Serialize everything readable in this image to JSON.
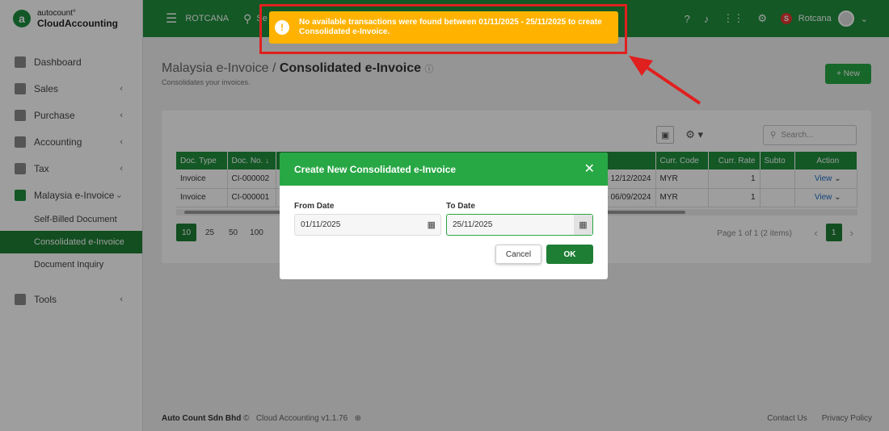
{
  "logo": {
    "top": "autocount°",
    "bottom": "CloudAccounting",
    "mark": "a"
  },
  "topbar": {
    "company": "ROTCANA",
    "search_partial": "Se",
    "user": "Rotcana",
    "badge": "S"
  },
  "sidebar": {
    "items": [
      {
        "label": "Dashboard"
      },
      {
        "label": "Sales"
      },
      {
        "label": "Purchase"
      },
      {
        "label": "Accounting"
      },
      {
        "label": "Tax"
      },
      {
        "label": "Malaysia e-Invoice"
      }
    ],
    "sub_items": [
      {
        "label": "Self-Billed Document"
      },
      {
        "label": "Consolidated e-Invoice"
      },
      {
        "label": "Document Inquiry"
      }
    ],
    "tools": "Tools"
  },
  "page": {
    "title_prefix": "Malaysia e-Invoice /",
    "title": "Consolidated e-Invoice",
    "subtitle": "Consolidates your invoices.",
    "new_button": "New",
    "search_placeholder": "Search..."
  },
  "table": {
    "headers": [
      "Doc. Type",
      "Doc. No.",
      "",
      "Curr. Code",
      "Curr. Rate",
      "Subto",
      "Action"
    ],
    "rows": [
      {
        "type": "Invoice",
        "no": "CI-000002",
        "range": "o 12/12/2024",
        "curr": "MYR",
        "rate": "1",
        "subtotal": "",
        "action": "View"
      },
      {
        "type": "Invoice",
        "no": "CI-000001",
        "range": "o 06/09/2024",
        "curr": "MYR",
        "rate": "1",
        "subtotal": "",
        "action": "View"
      }
    ]
  },
  "pagination": {
    "sizes": [
      "10",
      "25",
      "50",
      "100"
    ],
    "info": "Page 1 of 1 (2 items)",
    "current": "1"
  },
  "footer": {
    "company": "Auto Count Sdn Bhd",
    "copyright": "©",
    "version": "Cloud Accounting v1.1.76",
    "contact": "Contact Us",
    "privacy": "Privacy Policy"
  },
  "modal": {
    "title": "Create New Consolidated e-Invoice",
    "from_label": "From Date",
    "from_value": "01/11/2025",
    "to_label": "To Date",
    "to_value": "25/11/2025",
    "cancel": "Cancel",
    "ok": "OK"
  },
  "toast": {
    "message": "No available transactions were found between 01/11/2025 - 25/11/2025 to create Consolidated e-Invoice.",
    "icon": "!"
  },
  "colors": {
    "primary": "#1f8f3d",
    "warning": "#ffb300",
    "highlight": "#e0201f"
  }
}
